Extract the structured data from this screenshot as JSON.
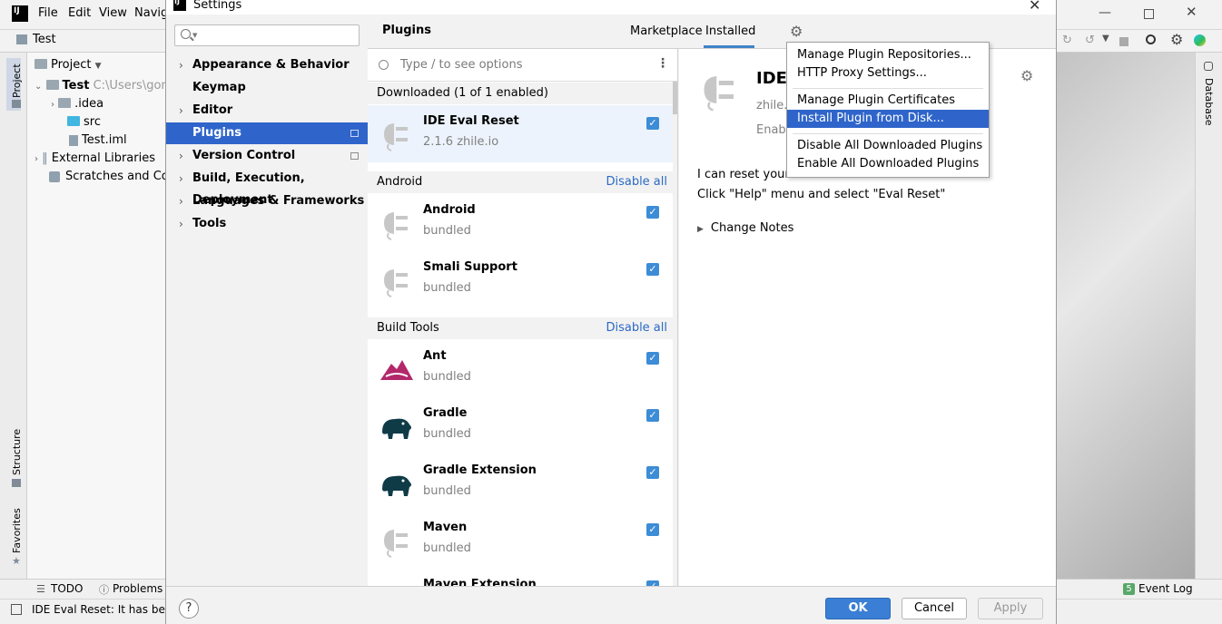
{
  "ide": {
    "logo": "IJ",
    "menu": [
      "File",
      "Edit",
      "View",
      "Navig"
    ],
    "project_title": "Test",
    "project_label": "Project",
    "tree": {
      "root": "Test",
      "root_path": "C:\\Users\\gon",
      "items": [
        ".idea",
        "src",
        "Test.iml",
        "External Libraries",
        "Scratches and Con"
      ]
    },
    "left_strip": {
      "project": "Project",
      "structure": "Structure",
      "favorites": "Favorites"
    },
    "right_strip": {
      "database": "Database"
    },
    "bottom": {
      "todo": "TODO",
      "problems": "Problems",
      "event_log": "Event Log",
      "event_count": "5"
    },
    "status_message": "IDE Eval Reset: It has bee"
  },
  "dialog": {
    "title": "Settings",
    "search_placeholder": "",
    "nav": [
      {
        "label": "Appearance & Behavior",
        "chevron": true
      },
      {
        "label": "Keymap",
        "chevron": false
      },
      {
        "label": "Editor",
        "chevron": true
      },
      {
        "label": "Plugins",
        "chevron": false,
        "selected": true
      },
      {
        "label": "Version Control",
        "chevron": true
      },
      {
        "label": "Build, Execution, Deployment",
        "chevron": true
      },
      {
        "label": "Languages & Frameworks",
        "chevron": true
      },
      {
        "label": "Tools",
        "chevron": true
      }
    ],
    "plugins_title": "Plugins",
    "tabs": {
      "marketplace": "Marketplace",
      "installed": "Installed"
    },
    "list_search_placeholder": "Type / to see options",
    "groups": {
      "downloaded": {
        "label": "Downloaded (1 of 1 enabled)"
      },
      "android": {
        "label": "Android",
        "action": "Disable all"
      },
      "build_tools": {
        "label": "Build Tools",
        "action": "Disable all"
      }
    },
    "plugins": {
      "ide_eval_reset": {
        "name": "IDE Eval Reset",
        "sub": "2.1.6  zhile.io",
        "checked": true
      },
      "android": {
        "name": "Android",
        "sub": "bundled",
        "checked": true
      },
      "smali": {
        "name": "Smali Support",
        "sub": "bundled",
        "checked": true
      },
      "ant": {
        "name": "Ant",
        "sub": "bundled",
        "checked": true
      },
      "gradle": {
        "name": "Gradle",
        "sub": "bundled",
        "checked": true
      },
      "gradle_ext": {
        "name": "Gradle Extension",
        "sub": "bundled",
        "checked": true
      },
      "maven": {
        "name": "Maven",
        "sub": "bundled",
        "checked": true
      },
      "maven_ext": {
        "name": "Maven Extension",
        "sub": "",
        "checked": true
      }
    },
    "detail": {
      "name": "IDE",
      "vendor": "zhile.i",
      "enabled": "Enabl",
      "desc_line1": "I can reset your IDE eval information.",
      "desc_line2": "Click \"Help\" menu and select \"Eval Reset\"",
      "change_notes": "Change Notes"
    },
    "footer": {
      "help": "?",
      "ok": "OK",
      "cancel": "Cancel",
      "apply": "Apply"
    },
    "popup": {
      "items": [
        "Manage Plugin Repositories...",
        "HTTP Proxy Settings...",
        "Manage Plugin Certificates",
        "Install Plugin from Disk...",
        "Disable All Downloaded Plugins",
        "Enable All Downloaded Plugins"
      ]
    }
  },
  "colors": {
    "accent": "#2f65ca",
    "link": "#2a6ac4",
    "checkbox": "#3d8cd6",
    "ok_button": "#3a7fd5"
  }
}
